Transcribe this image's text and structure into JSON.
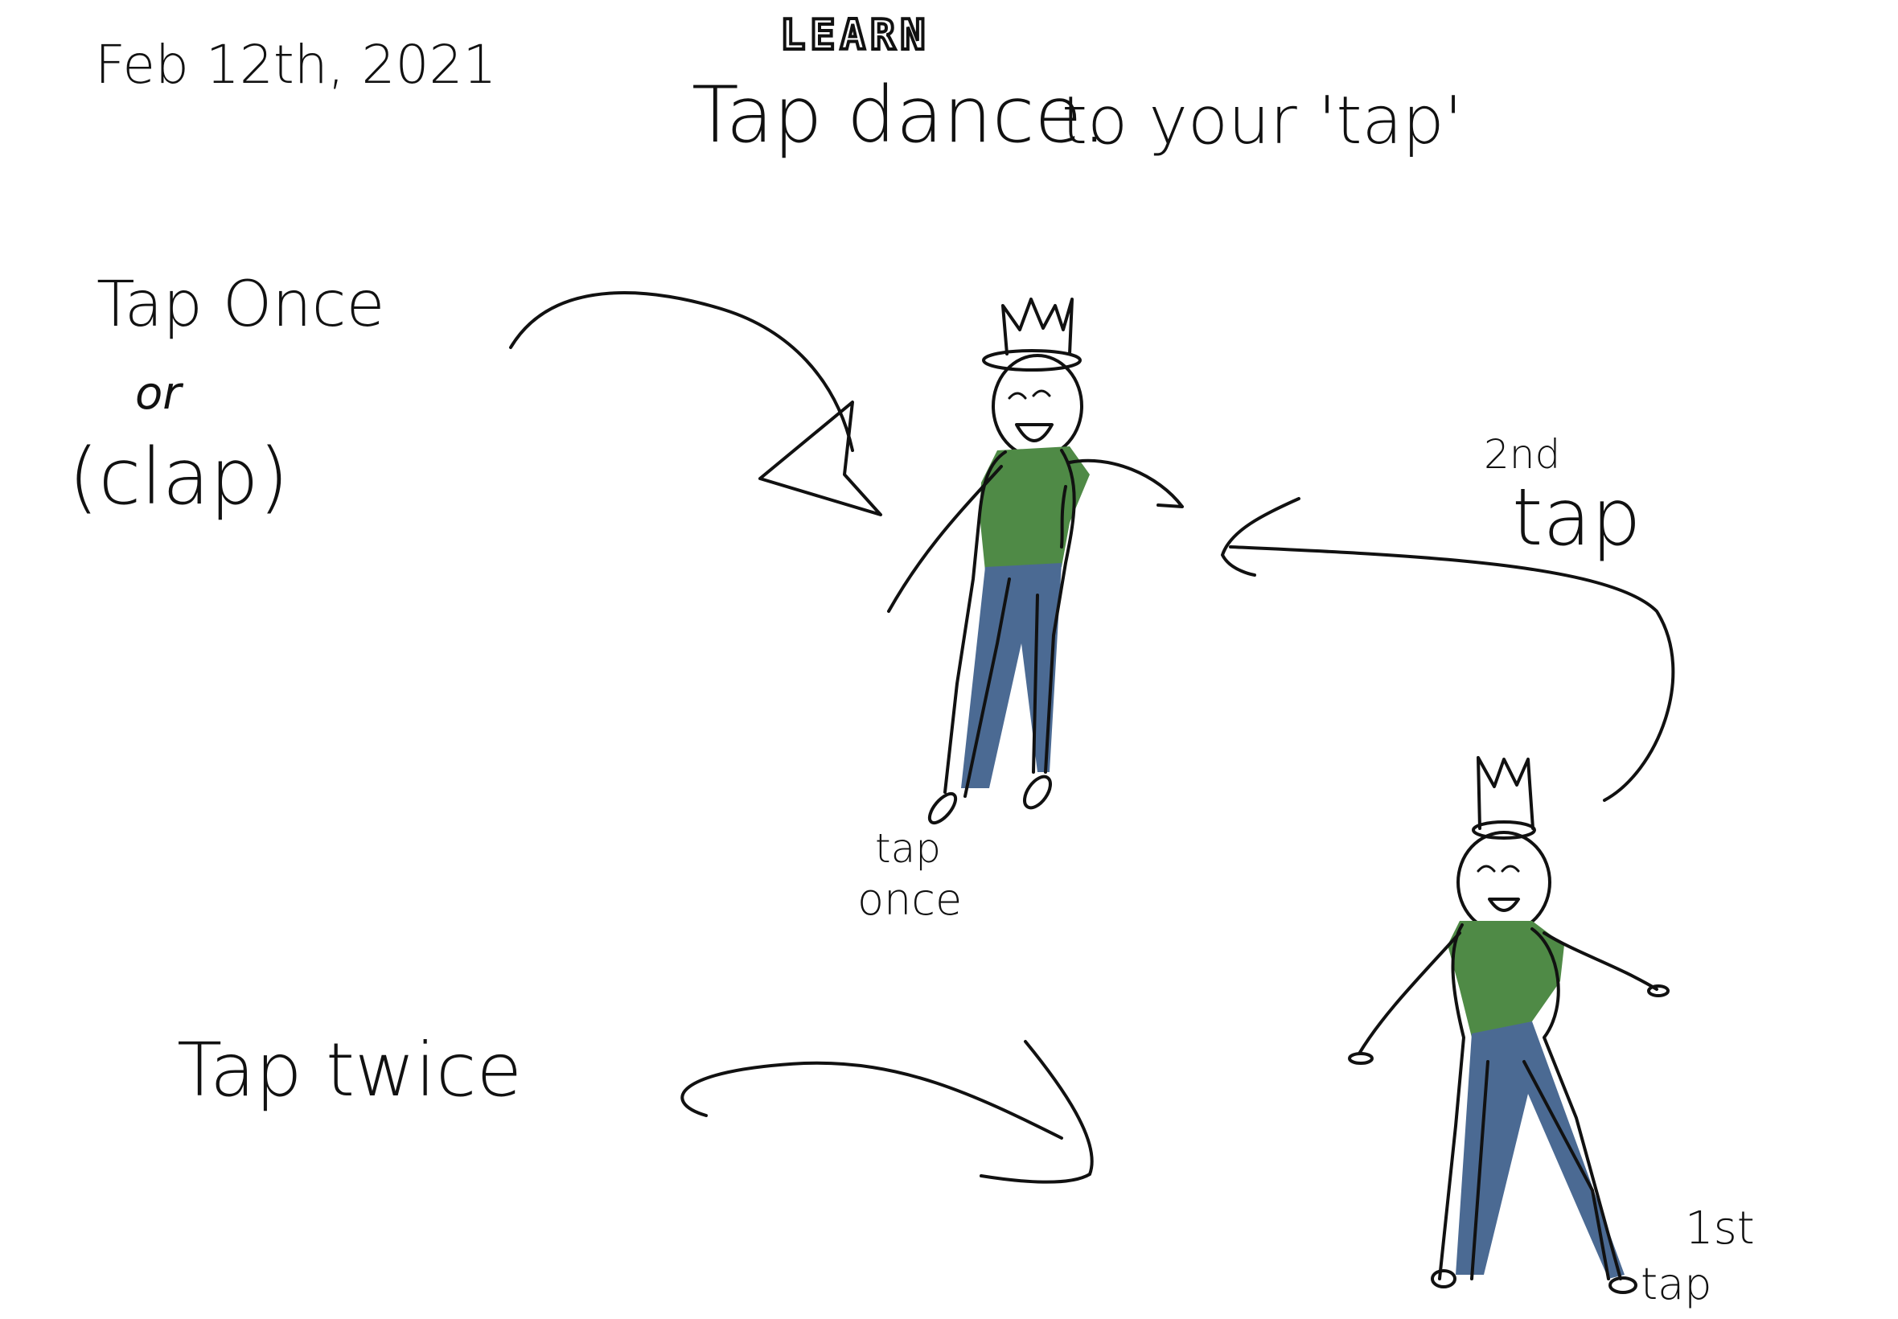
{
  "note": {
    "date": "Feb 12th, 2021",
    "header_word": "LEARN",
    "title_main": "Tap dance.",
    "title_sub": "to your 'tap'"
  },
  "left_labels": {
    "tap_once": "Tap Once",
    "or": "or",
    "clap": "(clap)",
    "tap_twice": "Tap twice"
  },
  "figure_labels": {
    "tap_once_line1": "tap",
    "tap_once_line2": "once",
    "second_tap_ordinal": "2nd",
    "second_tap_word": "tap",
    "first_tap_ordinal": "1st",
    "first_tap_word": "tap"
  },
  "colors": {
    "ink": "#111111",
    "shirt": "#4f8a46",
    "pants": "#4b6a93",
    "paper": "#ffffff"
  },
  "icons": [
    "crown-icon",
    "arrow-icon"
  ]
}
